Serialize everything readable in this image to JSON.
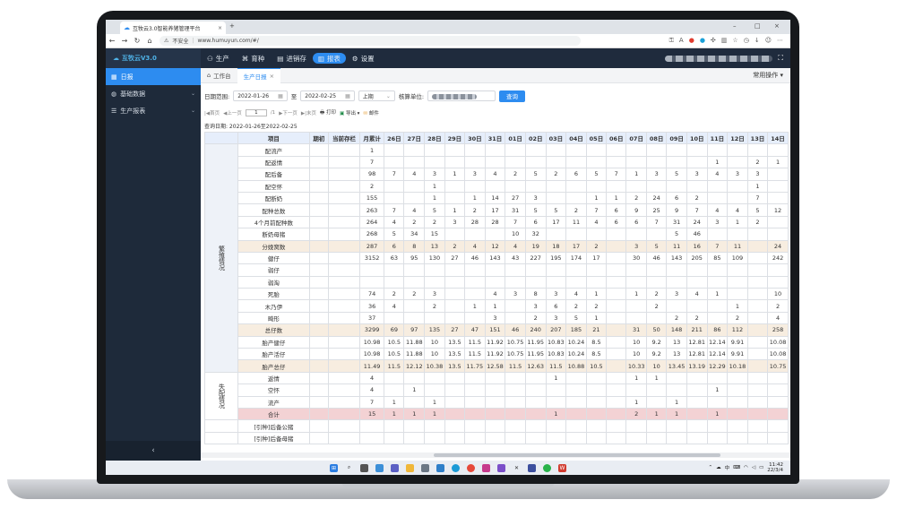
{
  "browser": {
    "tab_title": "互牧云3.0智能养猪管理平台",
    "address_security": "不安全",
    "url": "www.humuyun.com/#/"
  },
  "app": {
    "logo_text": "互牧云V3.0",
    "nav": [
      {
        "label": "生产",
        "icon": "pig-icon"
      },
      {
        "label": "育种",
        "icon": "dna-icon"
      },
      {
        "label": "进销存",
        "icon": "inventory-icon"
      },
      {
        "label": "报表",
        "icon": "report-icon",
        "active": true
      },
      {
        "label": "设置",
        "icon": "gear-icon"
      }
    ]
  },
  "sidebar": {
    "items": [
      {
        "label": "日报",
        "active": true
      },
      {
        "label": "基础数据"
      },
      {
        "label": "生产报表"
      }
    ],
    "collapse_glyph": "‹"
  },
  "content_tabs": [
    {
      "label": "工作台"
    },
    {
      "label": "生产日报",
      "active": true,
      "close": "×"
    }
  ],
  "common_ops": "常用操作 ▾",
  "filters": {
    "date_range_label": "日期范围:",
    "start_date": "2022-01-26",
    "to": "至",
    "end_date": "2022-02-25",
    "period": "上期",
    "unit_label": "核算单位:",
    "query_button": "查询"
  },
  "pager": {
    "first": "|◀首页",
    "prev": "◀上一页",
    "page": "1",
    "total": "/1",
    "next": "▶下一页",
    "last": "▶|末页",
    "print": "打印",
    "export": "导出 ▾",
    "mail": "邮件"
  },
  "query_date_text": "查询日期: 2022-01-26至2022-02-25",
  "table": {
    "headers": [
      "项目",
      "期初",
      "当前存栏",
      "月累计",
      "26日",
      "27日",
      "28日",
      "29日",
      "30日",
      "31日",
      "01日",
      "02日",
      "03日",
      "04日",
      "05日",
      "06日",
      "07日",
      "08日",
      "09日",
      "10日",
      "11日",
      "12日",
      "13日",
      "14日"
    ],
    "group_breed": "繁殖情况",
    "group_sow_loss": "失配情况",
    "rows": [
      {
        "item": "配流产",
        "cells": [
          "",
          "",
          "1",
          "",
          "",
          "",
          "",
          "",
          "",
          "",
          "",
          "",
          "",
          "",
          "",
          "",
          "",
          "",
          "",
          "",
          "",
          "",
          ""
        ]
      },
      {
        "item": "配返情",
        "cells": [
          "",
          "",
          "7",
          "",
          "",
          "",
          "",
          "",
          "",
          "",
          "",
          "",
          "",
          "",
          "",
          "",
          "",
          "",
          "",
          "1",
          "",
          "2",
          "1"
        ]
      },
      {
        "item": "配后备",
        "cells": [
          "",
          "",
          "98",
          "7",
          "4",
          "3",
          "1",
          "3",
          "4",
          "2",
          "5",
          "2",
          "6",
          "5",
          "7",
          "1",
          "3",
          "5",
          "3",
          "4",
          "3",
          "3",
          ""
        ]
      },
      {
        "item": "配空怀",
        "cells": [
          "",
          "",
          "2",
          "",
          "",
          "1",
          "",
          "",
          "",
          "",
          "",
          "",
          "",
          "",
          "",
          "",
          "",
          "",
          "",
          "",
          "",
          "1",
          ""
        ]
      },
      {
        "item": "配断奶",
        "cells": [
          "",
          "",
          "155",
          "",
          "",
          "1",
          "",
          "1",
          "14",
          "27",
          "3",
          "",
          "",
          "1",
          "1",
          "2",
          "24",
          "6",
          "2",
          "",
          "",
          "7",
          ""
        ]
      },
      {
        "item": "配种总数",
        "cells": [
          "",
          "",
          "263",
          "7",
          "4",
          "5",
          "1",
          "2",
          "17",
          "31",
          "5",
          "5",
          "2",
          "7",
          "6",
          "9",
          "25",
          "9",
          "7",
          "4",
          "4",
          "5",
          "12"
        ]
      },
      {
        "item": "4个月前配种数",
        "cells": [
          "",
          "",
          "264",
          "4",
          "2",
          "2",
          "3",
          "28",
          "28",
          "7",
          "6",
          "17",
          "11",
          "4",
          "6",
          "6",
          "7",
          "31",
          "24",
          "3",
          "1",
          "2",
          ""
        ]
      },
      {
        "item": "断奶母猪",
        "cells": [
          "",
          "",
          "268",
          "5",
          "34",
          "15",
          "",
          "",
          "",
          "10",
          "32",
          "",
          "",
          "",
          "",
          "",
          "",
          "5",
          "46",
          "",
          "",
          "",
          ""
        ]
      },
      {
        "item": "分娩窝数",
        "cells": [
          "",
          "",
          "287",
          "6",
          "8",
          "13",
          "2",
          "4",
          "12",
          "4",
          "19",
          "18",
          "17",
          "2",
          "",
          "3",
          "5",
          "11",
          "16",
          "7",
          "11",
          "",
          "24"
        ],
        "hl": "yellow"
      },
      {
        "item": "健仔",
        "cells": [
          "",
          "",
          "3152",
          "63",
          "95",
          "130",
          "27",
          "46",
          "143",
          "43",
          "227",
          "195",
          "174",
          "17",
          "",
          "30",
          "46",
          "143",
          "205",
          "85",
          "109",
          "",
          "242"
        ]
      },
      {
        "item": "弱仔",
        "cells": [
          "",
          "",
          "",
          "",
          "",
          "",
          "",
          "",
          "",
          "",
          "",
          "",
          "",
          "",
          "",
          "",
          "",
          "",
          "",
          "",
          "",
          "",
          ""
        ]
      },
      {
        "item": "弱淘",
        "cells": [
          "",
          "",
          "",
          "",
          "",
          "",
          "",
          "",
          "",
          "",
          "",
          "",
          "",
          "",
          "",
          "",
          "",
          "",
          "",
          "",
          "",
          "",
          ""
        ]
      },
      {
        "item": "死胎",
        "cells": [
          "",
          "",
          "74",
          "2",
          "2",
          "3",
          "",
          "",
          "4",
          "3",
          "8",
          "3",
          "4",
          "1",
          "",
          "1",
          "2",
          "3",
          "4",
          "1",
          "",
          "",
          "10"
        ]
      },
      {
        "item": "木乃伊",
        "cells": [
          "",
          "",
          "36",
          "4",
          "",
          "2",
          "",
          "1",
          "1",
          "",
          "3",
          "6",
          "2",
          "2",
          "",
          "",
          "2",
          "",
          "",
          "",
          "1",
          "",
          "2"
        ]
      },
      {
        "item": "畸形",
        "cells": [
          "",
          "",
          "37",
          "",
          "",
          "",
          "",
          "",
          "3",
          "",
          "2",
          "3",
          "5",
          "1",
          "",
          "",
          "",
          "2",
          "2",
          "",
          "2",
          "",
          "4"
        ]
      },
      {
        "item": "总仔数",
        "cells": [
          "",
          "",
          "3299",
          "69",
          "97",
          "135",
          "27",
          "47",
          "151",
          "46",
          "240",
          "207",
          "185",
          "21",
          "",
          "31",
          "50",
          "148",
          "211",
          "86",
          "112",
          "",
          "258"
        ],
        "hl": "yellow"
      },
      {
        "item": "胎产健仔",
        "cells": [
          "",
          "",
          "10.98",
          "10.5",
          "11.88",
          "10",
          "13.5",
          "11.5",
          "11.92",
          "10.75",
          "11.95",
          "10.83",
          "10.24",
          "8.5",
          "",
          "10",
          "9.2",
          "13",
          "12.81",
          "12.14",
          "9.91",
          "",
          "10.08"
        ]
      },
      {
        "item": "胎产活仔",
        "cells": [
          "",
          "",
          "10.98",
          "10.5",
          "11.88",
          "10",
          "13.5",
          "11.5",
          "11.92",
          "10.75",
          "11.95",
          "10.83",
          "10.24",
          "8.5",
          "",
          "10",
          "9.2",
          "13",
          "12.81",
          "12.14",
          "9.91",
          "",
          "10.08"
        ]
      },
      {
        "item": "胎产总仔",
        "cells": [
          "",
          "",
          "11.49",
          "11.5",
          "12.12",
          "10.38",
          "13.5",
          "11.75",
          "12.58",
          "11.5",
          "12.63",
          "11.5",
          "10.88",
          "10.5",
          "",
          "10.33",
          "10",
          "13.45",
          "13.19",
          "12.29",
          "10.18",
          "",
          "10.75"
        ],
        "hl": "yellow"
      },
      {
        "item": "返情",
        "cells": [
          "",
          "",
          "4",
          "",
          "",
          "",
          "",
          "",
          "",
          "",
          "",
          "1",
          "",
          "",
          "",
          "1",
          "1",
          "",
          "",
          "",
          "",
          "",
          ""
        ]
      },
      {
        "item": "空怀",
        "cells": [
          "",
          "",
          "4",
          "",
          "1",
          "",
          "",
          "",
          "",
          "",
          "",
          "",
          "",
          "",
          "",
          "",
          "",
          "",
          "",
          "1",
          "",
          "",
          ""
        ]
      },
      {
        "item": "流产",
        "cells": [
          "",
          "",
          "7",
          "1",
          "",
          "1",
          "",
          "",
          "",
          "",
          "",
          "",
          "",
          "",
          "",
          "1",
          "",
          "1",
          "",
          "",
          "",
          "",
          ""
        ]
      },
      {
        "item": "合计",
        "cells": [
          "",
          "",
          "15",
          "1",
          "1",
          "1",
          "",
          "",
          "",
          "",
          "",
          "1",
          "",
          "",
          "",
          "2",
          "1",
          "1",
          "",
          "1",
          "",
          "",
          ""
        ],
        "hl": "red"
      },
      {
        "item": "[引种]后备公猪",
        "cells": [
          "",
          "",
          "",
          "",
          "",
          "",
          "",
          "",
          "",
          "",
          "",
          "",
          "",
          "",
          "",
          "",
          "",
          "",
          "",
          "",
          "",
          "",
          ""
        ]
      },
      {
        "item": "[引种]后备母猪",
        "cells": [
          "",
          "",
          "",
          "",
          "",
          "",
          "",
          "",
          "",
          "",
          "",
          "",
          "",
          "",
          "",
          "",
          "",
          "",
          "",
          "",
          "",
          "",
          ""
        ]
      }
    ]
  },
  "taskbar": {
    "tray_lang": "中",
    "time": "11:42",
    "date": "22/3/4"
  }
}
